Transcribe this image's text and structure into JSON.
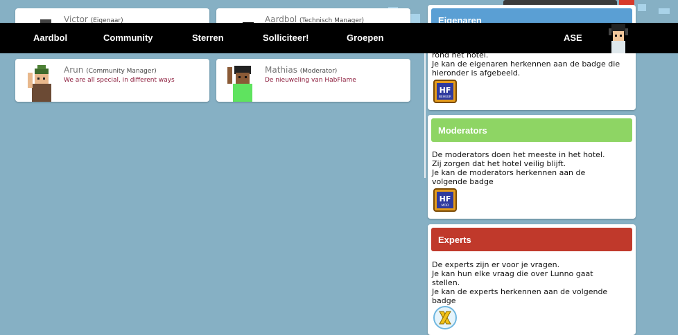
{
  "staff": [
    {
      "name": "Victor",
      "role": "(Eigenaar)",
      "motto": ""
    },
    {
      "name": "Aardbol",
      "role": "(Technisch Manager)",
      "motto": ""
    },
    {
      "name": "Arun",
      "role": "(Community Manager)",
      "motto": "We are all special, in different ways"
    },
    {
      "name": "Mathias",
      "role": "(Moderator)",
      "motto": "De nieuweling van HabFlame"
    }
  ],
  "nav": {
    "items": [
      "Aardbol",
      "Community",
      "Sterren",
      "Solliciteer!",
      "Groepen"
    ],
    "user": "ASE"
  },
  "panels": {
    "owners": {
      "title": "Eigenaren",
      "lines": [
        "rond het hotel.",
        "Je kan de eigenaren herkennen aan de badge die",
        "hieronder is afgebeeld."
      ],
      "badge": "HF",
      "badge_sub": "BEHEER",
      "color": "#5a9fd4"
    },
    "moderators": {
      "title": "Moderators",
      "lines": [
        "De moderators doen het meeste in het hotel.",
        "Zij zorgen dat het hotel veilig blijft.",
        "Je kan de moderators herkennen aan de",
        "volgende badge"
      ],
      "badge": "HF",
      "badge_sub": "MOD",
      "color": "#8ed564"
    },
    "experts": {
      "title": "Experts",
      "lines": [
        "De experts zijn er voor je vragen.",
        "Je kan hun elke vraag die over Lunno gaat",
        "stellen.",
        "Je kan de experts herkennen aan de volgende",
        "badge"
      ],
      "color": "#c0392b"
    }
  }
}
